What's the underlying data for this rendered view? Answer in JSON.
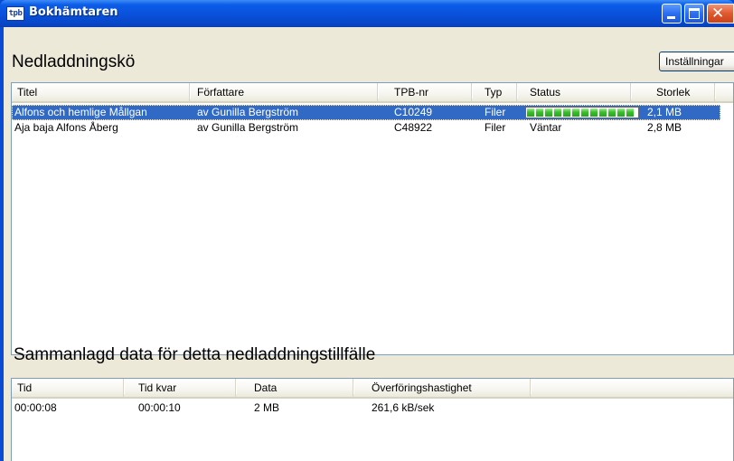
{
  "window": {
    "title": "Bokhämtaren",
    "icon_text": "tpb"
  },
  "queue": {
    "title": "Nedladdningskö",
    "settings_label": "Inställningar",
    "columns": [
      "Titel",
      "Författare",
      "TPB-nr",
      "Typ",
      "Status",
      "Storlek"
    ],
    "rows": [
      {
        "title": "Alfons och hemlige Mållgan",
        "author": "av Gunilla Bergström",
        "tpb": "C10249",
        "type": "Filer",
        "status": "",
        "progress": 1.0,
        "size": "2,1 MB",
        "selected": true
      },
      {
        "title": "Aja baja Alfons Åberg",
        "author": "av Gunilla Bergström",
        "tpb": "C48922",
        "type": "Filer",
        "status": "Väntar",
        "progress": null,
        "size": "2,8 MB",
        "selected": false
      }
    ]
  },
  "summary": {
    "title": "Sammanlagd data för detta nedladdningstillfälle",
    "columns": [
      "Tid",
      "Tid kvar",
      "Data",
      "Överföringshastighet"
    ],
    "rows": [
      {
        "time": "00:00:08",
        "remaining": "00:00:10",
        "data": "2 MB",
        "speed": "261,6 kB/sek"
      }
    ]
  },
  "colors": {
    "titlebar": "#0a52dc",
    "selection": "#316ac5",
    "progress": "#37c02a",
    "client": "#ece9d8"
  }
}
